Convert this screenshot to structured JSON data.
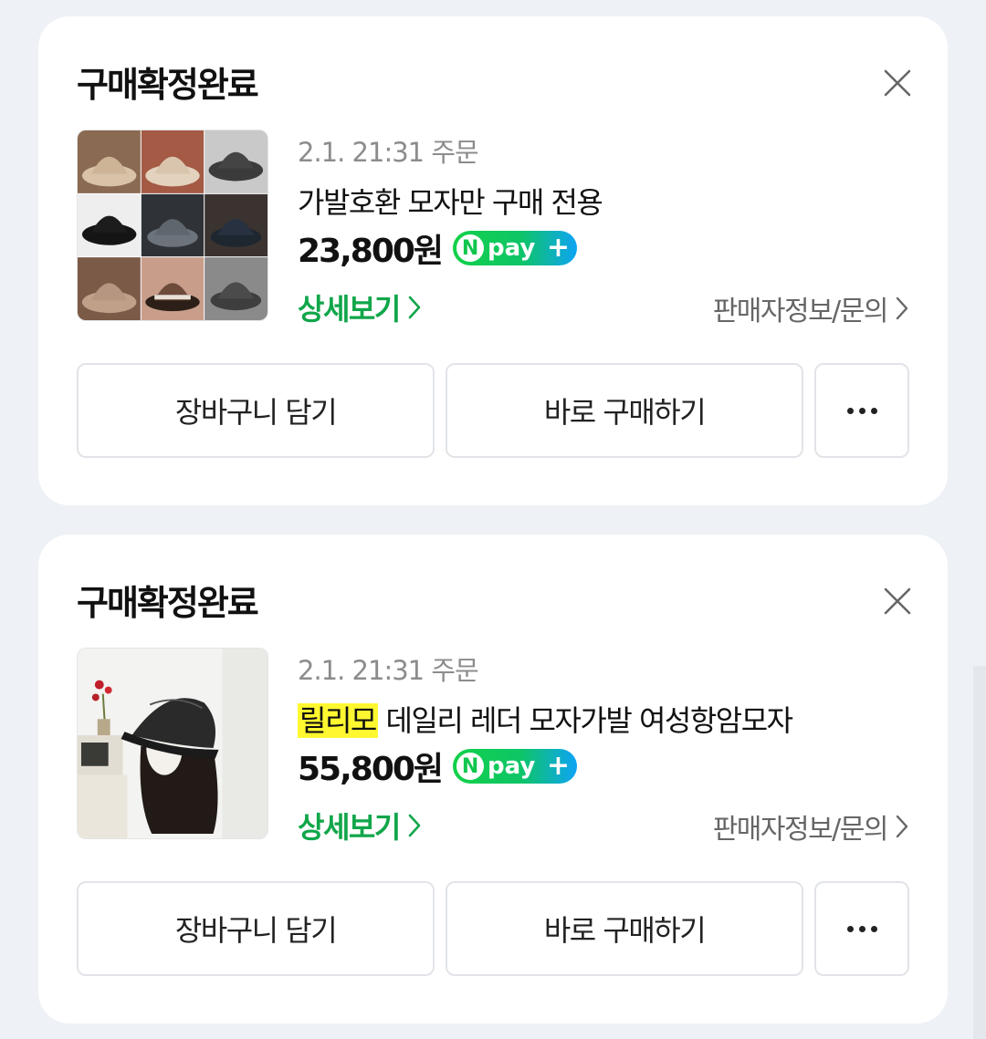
{
  "orders": [
    {
      "status": "구매확정완료",
      "order_date": "2.1. 21:31 주문",
      "highlight": "",
      "product_name": "가발호환 모자만 구매 전용",
      "price": "23,800원",
      "npay": {
        "n": "N",
        "text": "pay",
        "plus": "+"
      },
      "details_label": "상세보기",
      "seller_label": "판매자정보/문의",
      "cart_label": "장바구니 담기",
      "buy_label": "바로 구매하기"
    },
    {
      "status": "구매확정완료",
      "order_date": "2.1. 21:31 주문",
      "highlight": "릴리모",
      "product_name": " 데일리 레더 모자가발 여성항암모자",
      "price": "55,800원",
      "npay": {
        "n": "N",
        "text": "pay",
        "plus": "+"
      },
      "details_label": "상세보기",
      "seller_label": "판매자정보/문의",
      "cart_label": "장바구니 담기",
      "buy_label": "바로 구매하기"
    }
  ],
  "colors": {
    "accent_green": "#10a64a",
    "highlight_yellow": "#fff830",
    "npay_start": "#12d148",
    "npay_end": "#0da3f5"
  },
  "icons": [
    "close-icon",
    "chevron-right-icon",
    "more-dots-icon",
    "npay-logo-icon"
  ]
}
